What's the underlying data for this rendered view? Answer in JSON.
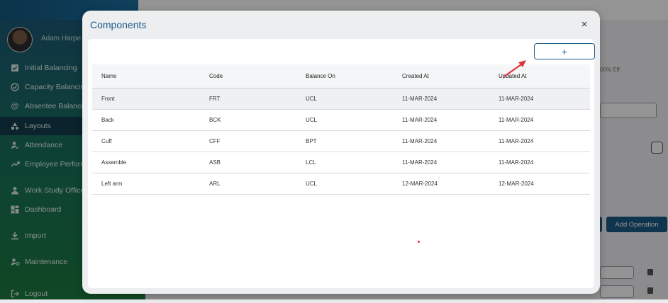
{
  "sidebar": {
    "user_name": "Adam Harpe",
    "items": [
      {
        "label": "Initial Balancing",
        "icon": "checklist-icon"
      },
      {
        "label": "Capacity Balancing",
        "icon": "check-circle-icon"
      },
      {
        "label": "Absentee Balancing",
        "icon": "at-sign-icon"
      },
      {
        "label": "Layouts",
        "icon": "shapes-icon"
      },
      {
        "label": "Attendance",
        "icon": "person-check-icon"
      },
      {
        "label": "Employee Perform",
        "icon": "trending-up-icon"
      },
      {
        "label": "Work Study Office",
        "icon": "person-icon"
      },
      {
        "label": "Dashboard",
        "icon": "dashboard-icon"
      },
      {
        "label": "Import",
        "icon": "download-icon"
      },
      {
        "label": "Maintenance",
        "icon": "people-gear-icon"
      },
      {
        "label": "Logout",
        "icon": "logout-icon"
      }
    ]
  },
  "background": {
    "efficiency_text": "00% Eff.",
    "add_operation_label": "Add Operation"
  },
  "modal": {
    "title": "Components",
    "close_glyph": "×",
    "add_glyph": "+",
    "columns": [
      "Name",
      "Code",
      "Balance On",
      "Created At",
      "Updated At"
    ],
    "rows": [
      [
        "Front",
        "FRT",
        "UCL",
        "11-MAR-2024",
        "11-MAR-2024"
      ],
      [
        "Back",
        "BCK",
        "UCL",
        "11-MAR-2024",
        "11-MAR-2024"
      ],
      [
        "Cuff",
        "CFF",
        "BPT",
        "11-MAR-2024",
        "11-MAR-2024"
      ],
      [
        "Assemble",
        "ASB",
        "LCL",
        "11-MAR-2024",
        "11-MAR-2024"
      ],
      [
        "Left arm",
        "ARL",
        "UCL",
        "12-MAR-2024",
        "12-MAR-2024"
      ]
    ]
  },
  "colors": {
    "accent": "#1e5c8a",
    "annotation_arrow": "#e0323c"
  }
}
